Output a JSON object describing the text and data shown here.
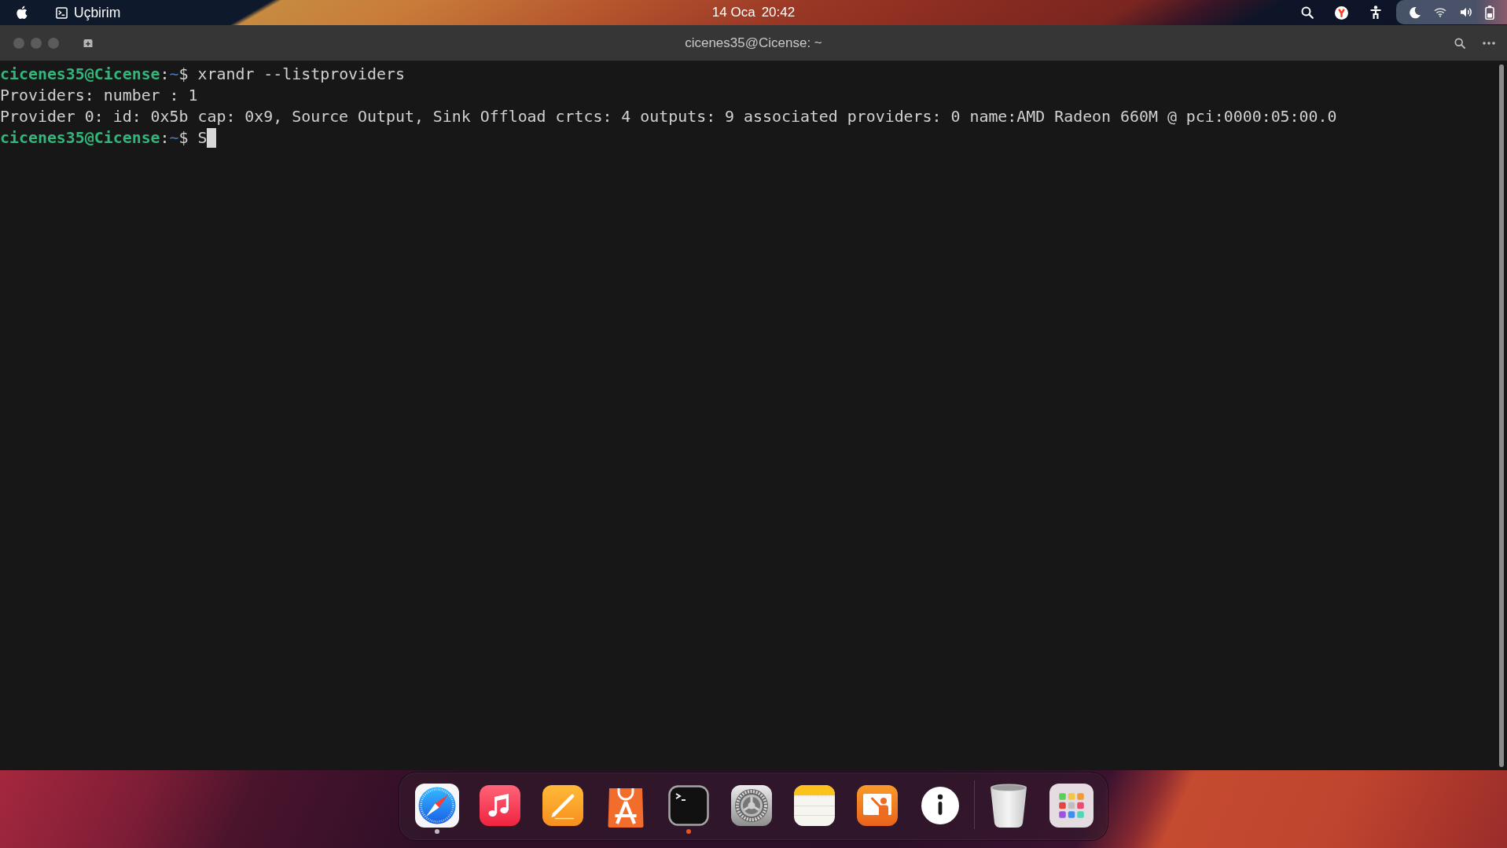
{
  "top_bar": {
    "app_name": "Uçbirim",
    "date": "14 Oca",
    "time": "20:42"
  },
  "terminal": {
    "title": "cicenes35@Cicense: ~",
    "lines": [
      {
        "kind": "prompt",
        "user": "cicenes35@Cicense",
        "separator": ":",
        "path": "~",
        "symbol": "$",
        "command": "xrandr --listproviders",
        "cursor": false
      },
      {
        "kind": "output",
        "text": "Providers: number : 1",
        "cursor": false
      },
      {
        "kind": "output",
        "text": "Provider 0: id: 0x5b cap: 0x9, Source Output, Sink Offload crtcs: 4 outputs: 9 associated providers: 0 name:AMD Radeon 660M @ pci:0000:05:00.0",
        "cursor": false
      },
      {
        "kind": "prompt",
        "user": "cicenes35@Cicense",
        "separator": ":",
        "path": "~",
        "symbol": "$",
        "command": "S",
        "cursor": true
      }
    ]
  },
  "dock": {
    "apps": [
      {
        "kind": "compass",
        "running": true,
        "color": "#c3b6c4"
      },
      {
        "kind": "music",
        "running": false
      },
      {
        "kind": "pen",
        "running": false
      },
      {
        "kind": "store",
        "running": false
      },
      {
        "kind": "terminal",
        "running": true,
        "color": "#e95420"
      },
      {
        "kind": "settings",
        "running": false
      },
      {
        "kind": "notes",
        "running": false
      },
      {
        "kind": "presentation",
        "running": false
      },
      {
        "kind": "info",
        "running": false
      }
    ],
    "extras": [
      {
        "kind": "trash",
        "running": false
      },
      {
        "kind": "launcher",
        "running": false
      }
    ]
  }
}
